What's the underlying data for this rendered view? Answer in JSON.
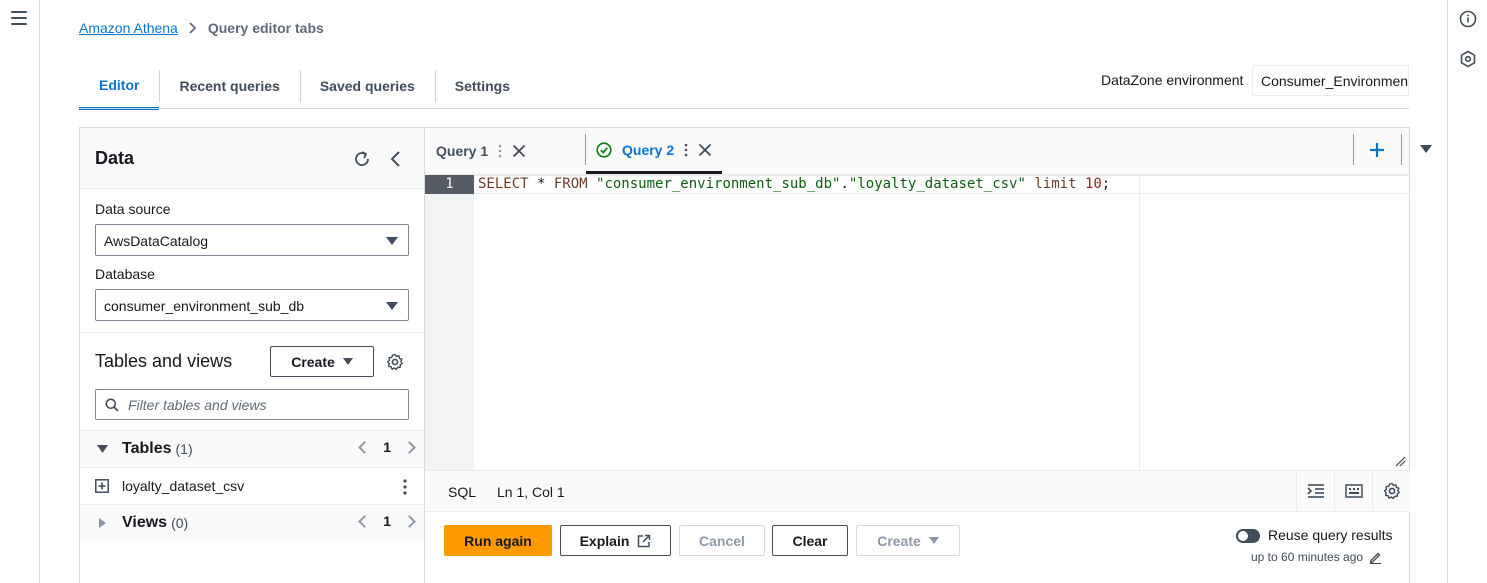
{
  "breadcrumb": {
    "root": "Amazon Athena",
    "current": "Query editor tabs"
  },
  "tabs": [
    {
      "label": "Editor"
    },
    {
      "label": "Recent queries"
    },
    {
      "label": "Saved queries"
    },
    {
      "label": "Settings"
    }
  ],
  "datazone": {
    "label": "DataZone environment",
    "value": "Consumer_Environment"
  },
  "data_panel": {
    "title": "Data",
    "data_source": {
      "label": "Data source",
      "value": "AwsDataCatalog"
    },
    "database": {
      "label": "Database",
      "value": "consumer_environment_sub_db"
    },
    "tables_and_views": {
      "title": "Tables and views",
      "create_label": "Create",
      "filter_placeholder": "Filter tables and views",
      "tables": {
        "label": "Tables",
        "count": "(1)",
        "page": "1"
      },
      "table_item": "loyalty_dataset_csv",
      "views": {
        "label": "Views",
        "count": "(0)",
        "page": "1"
      }
    }
  },
  "editor": {
    "query_tabs": [
      {
        "label": "Query 1"
      },
      {
        "label": "Query 2"
      }
    ],
    "line_number": "1",
    "code": {
      "select": "SELECT",
      "star": " * ",
      "from": "FROM",
      "db": " \"consumer_environment_sub_db\"",
      "dot": ".",
      "table": "\"loyalty_dataset_csv\"",
      "limit": " limit ",
      "num": "10",
      "end": ";"
    },
    "status": {
      "language": "SQL",
      "position": "Ln 1, Col 1"
    }
  },
  "actions": {
    "run": "Run again",
    "explain": "Explain",
    "cancel": "Cancel",
    "clear": "Clear",
    "create": "Create",
    "reuse_label": "Reuse query results",
    "reuse_sub": "up to 60 minutes ago"
  },
  "colors": {
    "accent": "#0972d3",
    "primary_button": "#ff9900",
    "success": "#037f0c"
  }
}
